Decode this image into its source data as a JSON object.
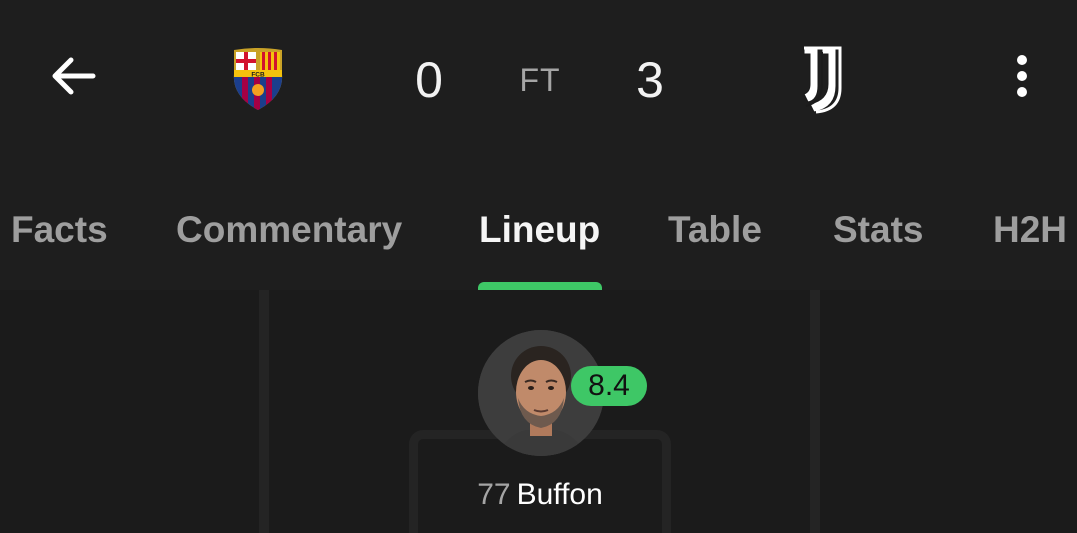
{
  "match": {
    "home_score": "0",
    "away_score": "3",
    "status": "FT",
    "home_crest_text": "FCB"
  },
  "tabs": [
    {
      "label": "Facts"
    },
    {
      "label": "Commentary"
    },
    {
      "label": "Lineup",
      "active": true
    },
    {
      "label": "Table"
    },
    {
      "label": "Stats"
    },
    {
      "label": "H2H"
    }
  ],
  "lineup": {
    "player": {
      "number": "77",
      "name": "Buffon",
      "rating": "8.4",
      "rating_color": "#3ec766"
    }
  },
  "icons": {
    "back": "arrow-left-icon",
    "more": "more-vertical-icon"
  },
  "colors": {
    "accent": "#3ec766",
    "background": "#1b1b1b"
  }
}
